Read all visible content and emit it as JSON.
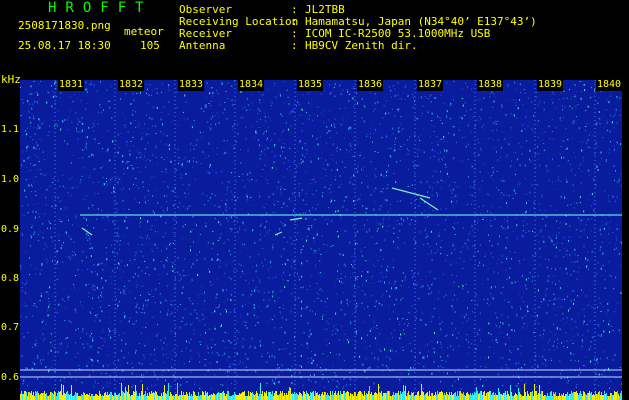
{
  "header": {
    "app_title": "HROFFT",
    "file_name": "2508171830.png",
    "mode": "meteor",
    "date_time": "25.08.17 18:30",
    "count": "105"
  },
  "info": [
    {
      "label": "Observer",
      "value": "JL2TBB"
    },
    {
      "label": "Receiving Location",
      "value": "Hamamatsu, Japan (N34°40’ E137°43’)"
    },
    {
      "label": "Receiver",
      "value": "ICOM IC-R2500 53.1000MHz USB"
    },
    {
      "label": "Antenna",
      "value": "HB9CV Zenith dir."
    }
  ],
  "axis": {
    "unit": "kHz",
    "y_ticks": [
      "1.1",
      "1.0",
      "0.9",
      "0.8",
      "0.7",
      "0.6"
    ],
    "x_ticks": [
      "1831",
      "1832",
      "1833",
      "1834",
      "1835",
      "1836",
      "1837",
      "1838",
      "1839",
      "1840"
    ]
  },
  "colors": {
    "background": "#000000",
    "spectrogram_base": "#0a1c9e",
    "text_yellow": "#ffff00",
    "text_green": "#00ff00"
  }
}
